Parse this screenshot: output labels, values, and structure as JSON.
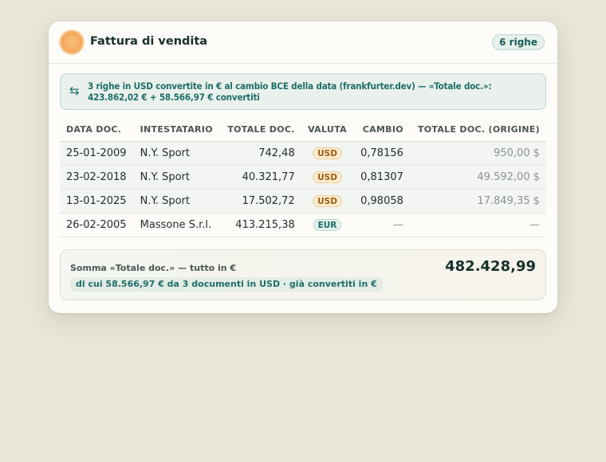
{
  "header": {
    "title": "Fattura di vendita",
    "rows_badge": "6 righe",
    "logo_icon": "sun-orb-icon"
  },
  "notice": {
    "icon": "swap-arrows-icon",
    "text": "3 righe in USD convertite in € al cambio BCE della data (frankfurter.dev) — «Totale doc.»: 423.862,02 € + 58.566,97 € convertiti"
  },
  "table": {
    "columns": [
      "DATA DOC.",
      "INTESTATARIO",
      "TOTALE DOC.",
      "VALUTA",
      "CAMBIO",
      "TOTALE DOC. (ORIGINE)"
    ],
    "rows": [
      [
        "25-01-2009",
        "N.Y. Sport",
        "742,48",
        "USD",
        "0,78156",
        "950,00 $"
      ],
      [
        "23-02-2018",
        "N.Y. Sport",
        "40.321,77",
        "USD",
        "0,81307",
        "49.592,00 $"
      ],
      [
        "13-01-2025",
        "N.Y. Sport",
        "17.502,72",
        "USD",
        "0,98058",
        "17.849,35 $"
      ],
      [
        "26-02-2005",
        "Massone S.r.l.",
        "413.215,38",
        "EUR",
        "—",
        "—"
      ]
    ]
  },
  "summary": {
    "label": "Somma «Totale doc.» — tutto in €",
    "detail": "di cui 58.566,97 € da 3 documenti in USD · già convertiti in €",
    "value": "482.428,99"
  },
  "colors": {
    "accent": "#1f6e68",
    "usd_badge": "#a55a12",
    "eur_badge": "#1c6e65",
    "background": "#e8e5d9"
  }
}
